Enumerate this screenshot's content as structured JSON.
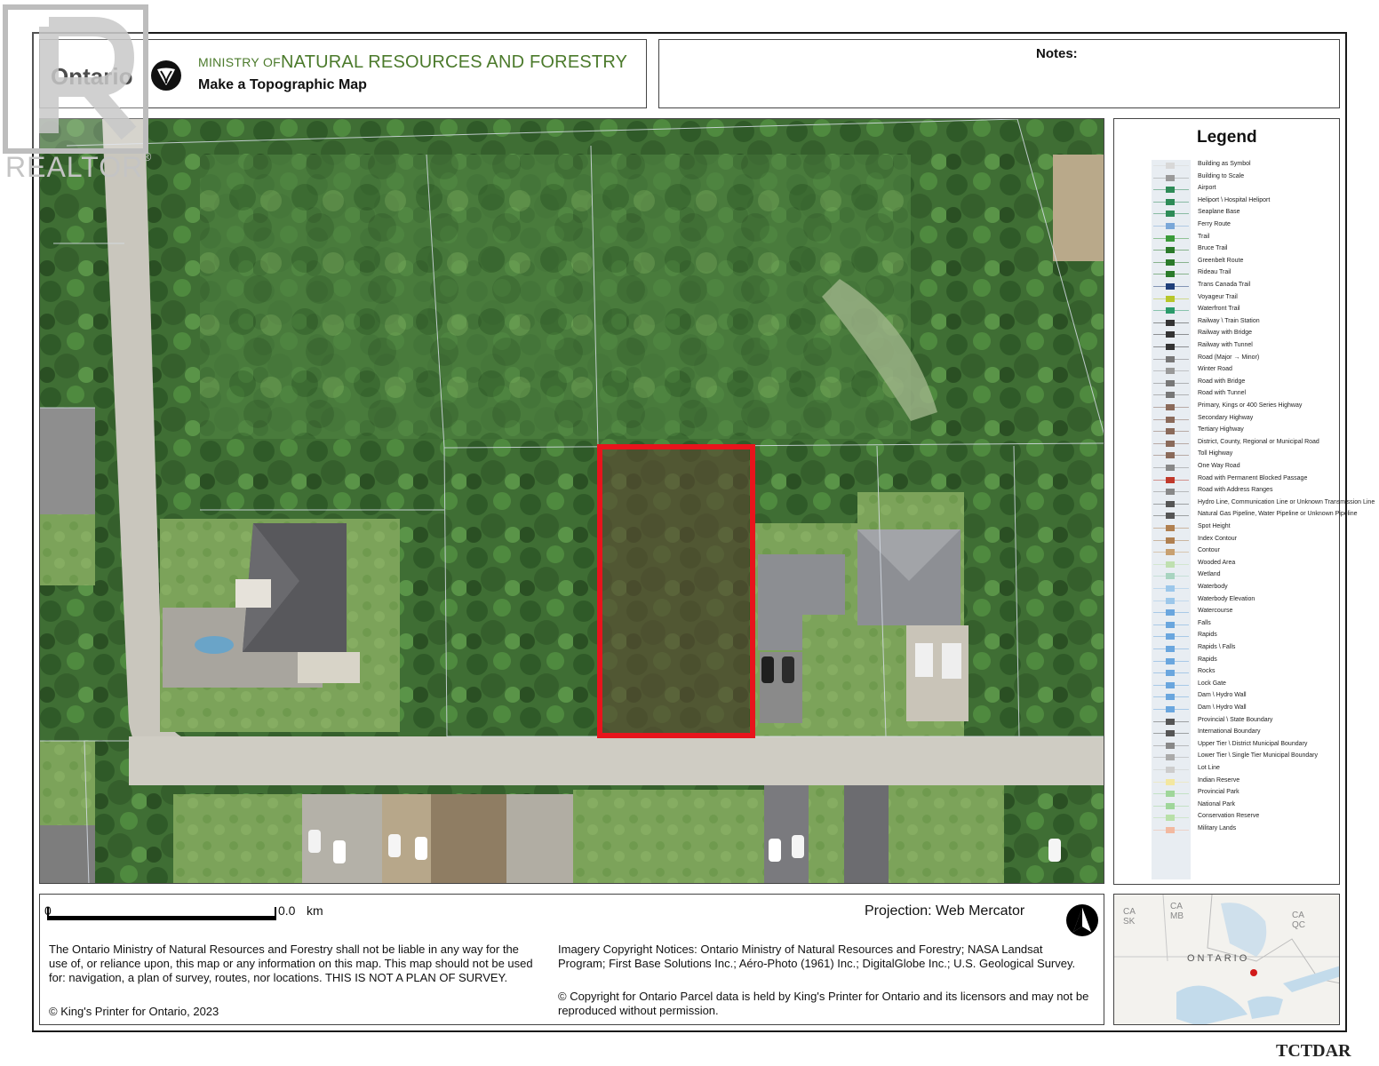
{
  "watermark": {
    "text": "REALTOR",
    "mark": "®"
  },
  "header": {
    "brand": "Ontario",
    "ministry_prefix": "MINISTRY OF",
    "ministry_name": "NATURAL RESOURCES AND FORESTRY",
    "subtitle": "Make a Topographic Map"
  },
  "notes": {
    "label": "Notes:"
  },
  "legend": {
    "title": "Legend",
    "items": [
      {
        "label": "Building as Symbol",
        "color": "#d8d8d8"
      },
      {
        "label": "Building to Scale",
        "color": "#9a9a9a"
      },
      {
        "label": "Airport",
        "color": "#2e8b57"
      },
      {
        "label": "Heliport \\ Hospital Heliport",
        "color": "#2e8b57"
      },
      {
        "label": "Seaplane Base",
        "color": "#2e8b57"
      },
      {
        "label": "Ferry Route",
        "color": "#7aa7d8"
      },
      {
        "label": "Trail",
        "color": "#3a9a3a"
      },
      {
        "label": "Bruce Trail",
        "color": "#2a7a2a"
      },
      {
        "label": "Greenbelt Route",
        "color": "#2a7a2a"
      },
      {
        "label": "Rideau Trail",
        "color": "#2a7a2a"
      },
      {
        "label": "Trans Canada Trail",
        "color": "#1f3f7a"
      },
      {
        "label": "Voyageur Trail",
        "color": "#b7c62a"
      },
      {
        "label": "Waterfront Trail",
        "color": "#2a9a6a"
      },
      {
        "label": "Railway \\ Train Station",
        "color": "#333333"
      },
      {
        "label": "Railway with Bridge",
        "color": "#333333"
      },
      {
        "label": "Railway with Tunnel",
        "color": "#333333"
      },
      {
        "label": "Road (Major → Minor)",
        "color": "#777777"
      },
      {
        "label": "Winter Road",
        "color": "#999999"
      },
      {
        "label": "Road with Bridge",
        "color": "#777777"
      },
      {
        "label": "Road with Tunnel",
        "color": "#777777"
      },
      {
        "label": "Primary, Kings or 400 Series Highway",
        "color": "#8a6a5a"
      },
      {
        "label": "Secondary Highway",
        "color": "#8a6a5a"
      },
      {
        "label": "Tertiary Highway",
        "color": "#8a6a5a"
      },
      {
        "label": "District, County, Regional or Municipal Road",
        "color": "#8a6a5a"
      },
      {
        "label": "Toll Highway",
        "color": "#8a6a5a"
      },
      {
        "label": "One Way Road",
        "color": "#888888"
      },
      {
        "label": "Road with Permanent Blocked Passage",
        "color": "#c0392b"
      },
      {
        "label": "Road with Address Ranges",
        "color": "#888888"
      },
      {
        "label": "Hydro Line, Communication Line or Unknown Transmission Line",
        "color": "#555555"
      },
      {
        "label": "Natural Gas Pipeline, Water Pipeline or Unknown Pipeline",
        "color": "#555555"
      },
      {
        "label": "Spot Height",
        "color": "#b08050"
      },
      {
        "label": "Index Contour",
        "color": "#b08050"
      },
      {
        "label": "Contour",
        "color": "#c8a070"
      },
      {
        "label": "Wooded Area",
        "color": "#bfe0b0"
      },
      {
        "label": "Wetland",
        "color": "#a8d4c0"
      },
      {
        "label": "Waterbody",
        "color": "#9cc7ea"
      },
      {
        "label": "Waterbody Elevation",
        "color": "#9cc7ea"
      },
      {
        "label": "Watercourse",
        "color": "#6aa6de"
      },
      {
        "label": "Falls",
        "color": "#6aa6de"
      },
      {
        "label": "Rapids",
        "color": "#6aa6de"
      },
      {
        "label": "Rapids \\ Falls",
        "color": "#6aa6de"
      },
      {
        "label": "Rapids",
        "color": "#6aa6de"
      },
      {
        "label": "Rocks",
        "color": "#6aa6de"
      },
      {
        "label": "Lock Gate",
        "color": "#6aa6de"
      },
      {
        "label": "Dam \\ Hydro Wall",
        "color": "#6aa6de"
      },
      {
        "label": "Dam \\ Hydro Wall",
        "color": "#6aa6de"
      },
      {
        "label": "Provincial \\ State Boundary",
        "color": "#555555"
      },
      {
        "label": "International Boundary",
        "color": "#555555"
      },
      {
        "label": "Upper Tier \\ District Municipal Boundary",
        "color": "#888888"
      },
      {
        "label": "Lower Tier \\ Single Tier Municipal Boundary",
        "color": "#aaaaaa"
      },
      {
        "label": "Lot Line",
        "color": "#cccccc"
      },
      {
        "label": "Indian Reserve",
        "color": "#f3e7a0"
      },
      {
        "label": "Provincial Park",
        "color": "#9fd69a"
      },
      {
        "label": "National Park",
        "color": "#9fd69a"
      },
      {
        "label": "Conservation Reserve",
        "color": "#b8e0a8"
      },
      {
        "label": "Military Lands",
        "color": "#f2b9a0"
      }
    ]
  },
  "scale": {
    "start": "0",
    "end": "0.0",
    "unit": "km"
  },
  "projection": "Projection: Web Mercator",
  "disclaimer": "The Ontario Ministry of Natural Resources and Forestry shall not be liable in any way for the use of, or reliance upon, this map or any information on this map.  This map should not be used for: navigation, a plan of survey, routes, nor locations. THIS IS NOT A PLAN OF SURVEY.",
  "copyright": "© King's Printer for Ontario,  2023",
  "imagery_notice": "Imagery Copyright Notices: Ontario Ministry of Natural Resources and Forestry; NASA Landsat Program; First Base Solutions Inc.; Aéro-Photo (1961) Inc.; DigitalGlobe Inc.; U.S. Geological Survey.",
  "parcel_notice": "© Copyright for Ontario Parcel data is held by King's Printer for Ontario and its licensors and may not be reproduced without permission.",
  "inset_map": {
    "labels": [
      "CA SK",
      "CA MB",
      "CA QC",
      "ONTARIO"
    ],
    "marker_color": "#d11a1a"
  },
  "parcel": {
    "outline_color": "#e8141c"
  },
  "corner_tag": "TCTDAR"
}
